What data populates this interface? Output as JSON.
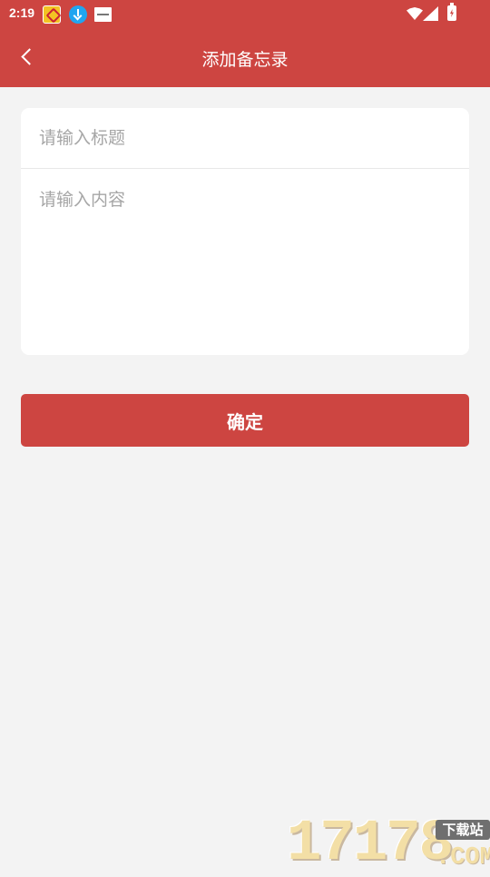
{
  "status_bar": {
    "time": "2:19",
    "notification_icons": [
      "app-notification-icon",
      "download-icon",
      "document-icon"
    ],
    "system_icons": [
      "wifi-icon",
      "signal-icon",
      "battery-charging-icon"
    ]
  },
  "header": {
    "title": "添加备忘录",
    "back_icon": "chevron-left-icon"
  },
  "form": {
    "title_placeholder": "请输入标题",
    "content_placeholder": "请输入内容",
    "title_value": "",
    "content_value": ""
  },
  "actions": {
    "confirm_label": "确定"
  },
  "watermark": {
    "number": "17178",
    "badge": "下载站",
    "suffix": ".COM"
  },
  "colors": {
    "primary": "#cd4541",
    "background": "#f3f3f3",
    "card": "#ffffff",
    "placeholder": "#a6a6a6"
  }
}
